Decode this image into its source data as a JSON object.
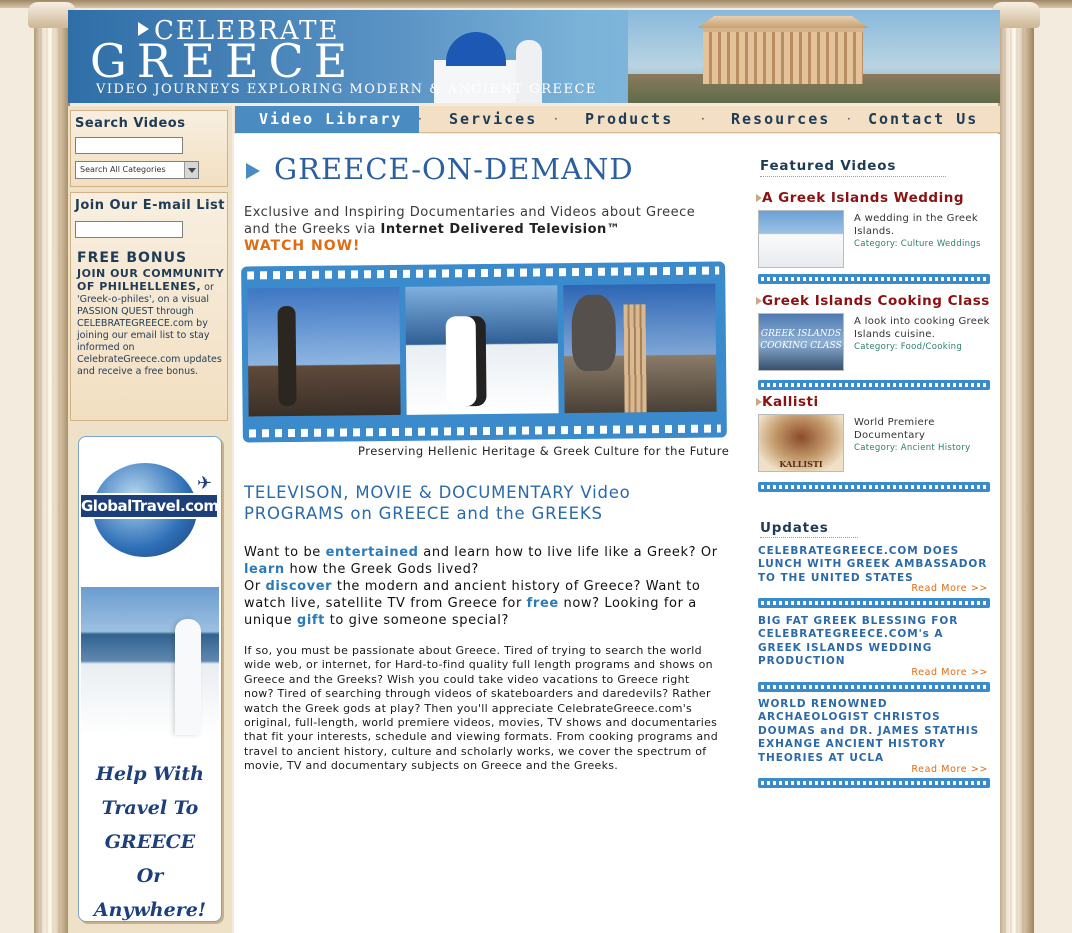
{
  "header": {
    "logo_top": "CELEBRATE",
    "logo_main": "GREECE",
    "logo_sub": "VIDEO JOURNEYS EXPLORING MODERN & ANCIENT GREECE"
  },
  "nav": {
    "items": [
      "Video Library",
      "Services",
      "Products",
      "Resources",
      "Contact Us"
    ],
    "separator": "·"
  },
  "sidebar": {
    "search_title": "Search Videos",
    "search_category": "Search All Categories",
    "email_title": "Join Our E-mail List",
    "bonus_title": "FREE BONUS",
    "bonus_line1": "JOIN OUR COMMUNITY OF PHILHELLENES,",
    "bonus_text": "or 'Greek-o-philes', on a visual PASSION QUEST through CELEBRATEGREECE.com by joining our email list to stay informed on CelebrateGreece.com updates and receive a free bonus.",
    "ad_logo": "GlobalTravel.com",
    "ad_line1": "Help With",
    "ad_line2": "Travel To",
    "ad_line3": "GREECE",
    "ad_line4": "Or Anywhere!"
  },
  "main": {
    "title": "GREECE-ON-DEMAND",
    "intro_1": "Exclusive and Inspiring Documentaries and Videos about Greece and the Greeks via ",
    "intro_bold": "Internet Delivered Television™",
    "watch_now": "WATCH NOW!",
    "caption": "Preserving Hellenic Heritage & Greek Culture for the Future",
    "section_heading": "TELEVISON, MOVIE & DOCUMENTARY Video PROGRAMS on GREECE and the GREEKS",
    "p1_a": "Want to be ",
    "p1_link1": "entertained",
    "p1_b": " and learn how to live life like a Greek? Or ",
    "p1_link2": "learn",
    "p1_c": " how the Greek Gods lived?",
    "p1_d": "Or ",
    "p1_link3": "discover",
    "p1_e": " the modern and ancient history of Greece? Want to watch live, satellite TV from Greece for ",
    "p1_link4": "free",
    "p1_f": " now? Looking for a unique ",
    "p1_link5": "gift",
    "p1_g": " to give someone special?",
    "p2": "If so, you must be passionate about Greece. Tired of trying to search the world wide web, or internet, for Hard-to-find quality full length programs and shows on Greece and the Greeks? Wish you could take video vacations to Greece right now? Tired of searching through videos of skateboarders and daredevils? Rather watch the Greek gods at play? Then you'll appreciate CelebrateGreece.com's original, full-length, world premiere videos, movies, TV shows and documentaries that fit your interests, schedule and viewing formats. From cooking programs and travel to ancient history, culture and scholarly works, we cover the spectrum of movie, TV and documentary subjects on Greece and the Greeks."
  },
  "featured": {
    "heading": "Featured Videos",
    "items": [
      {
        "title": "A Greek Islands Wedding",
        "desc": "A wedding in the Greek Islands.",
        "category": "Category: Culture Weddings"
      },
      {
        "title": "Greek Islands Cooking Class",
        "desc": "A look into cooking Greek Islands cuisine.",
        "category": "Category: Food/Cooking",
        "thumb_text": "GREEK ISLANDS COOKING CLASS"
      },
      {
        "title": "Kallisti",
        "desc": "World Premiere Documentary",
        "category": "Category: Ancient History",
        "thumb_text": "KALLISTI"
      }
    ]
  },
  "updates": {
    "heading": "Updates",
    "read_more": "Read More >>",
    "items": [
      "CELEBRATEGREECE.COM DOES LUNCH WITH GREEK AMBASSADOR TO THE UNITED STATES",
      "BIG FAT GREEK BLESSING FOR CELEBRATEGREECE.COM's A GREEK ISLANDS WEDDING PRODUCTION",
      "WORLD RENOWNED ARCHAEOLOGIST CHRISTOS DOUMAS and DR. JAMES STATHIS EXHANGE ANCIENT HISTORY THEORIES AT UCLA"
    ]
  },
  "colors": {
    "accent_blue": "#2c69a8",
    "nav_bg": "#f3dfc4",
    "feature_red": "#8a1212",
    "watch_orange": "#e06b12"
  }
}
